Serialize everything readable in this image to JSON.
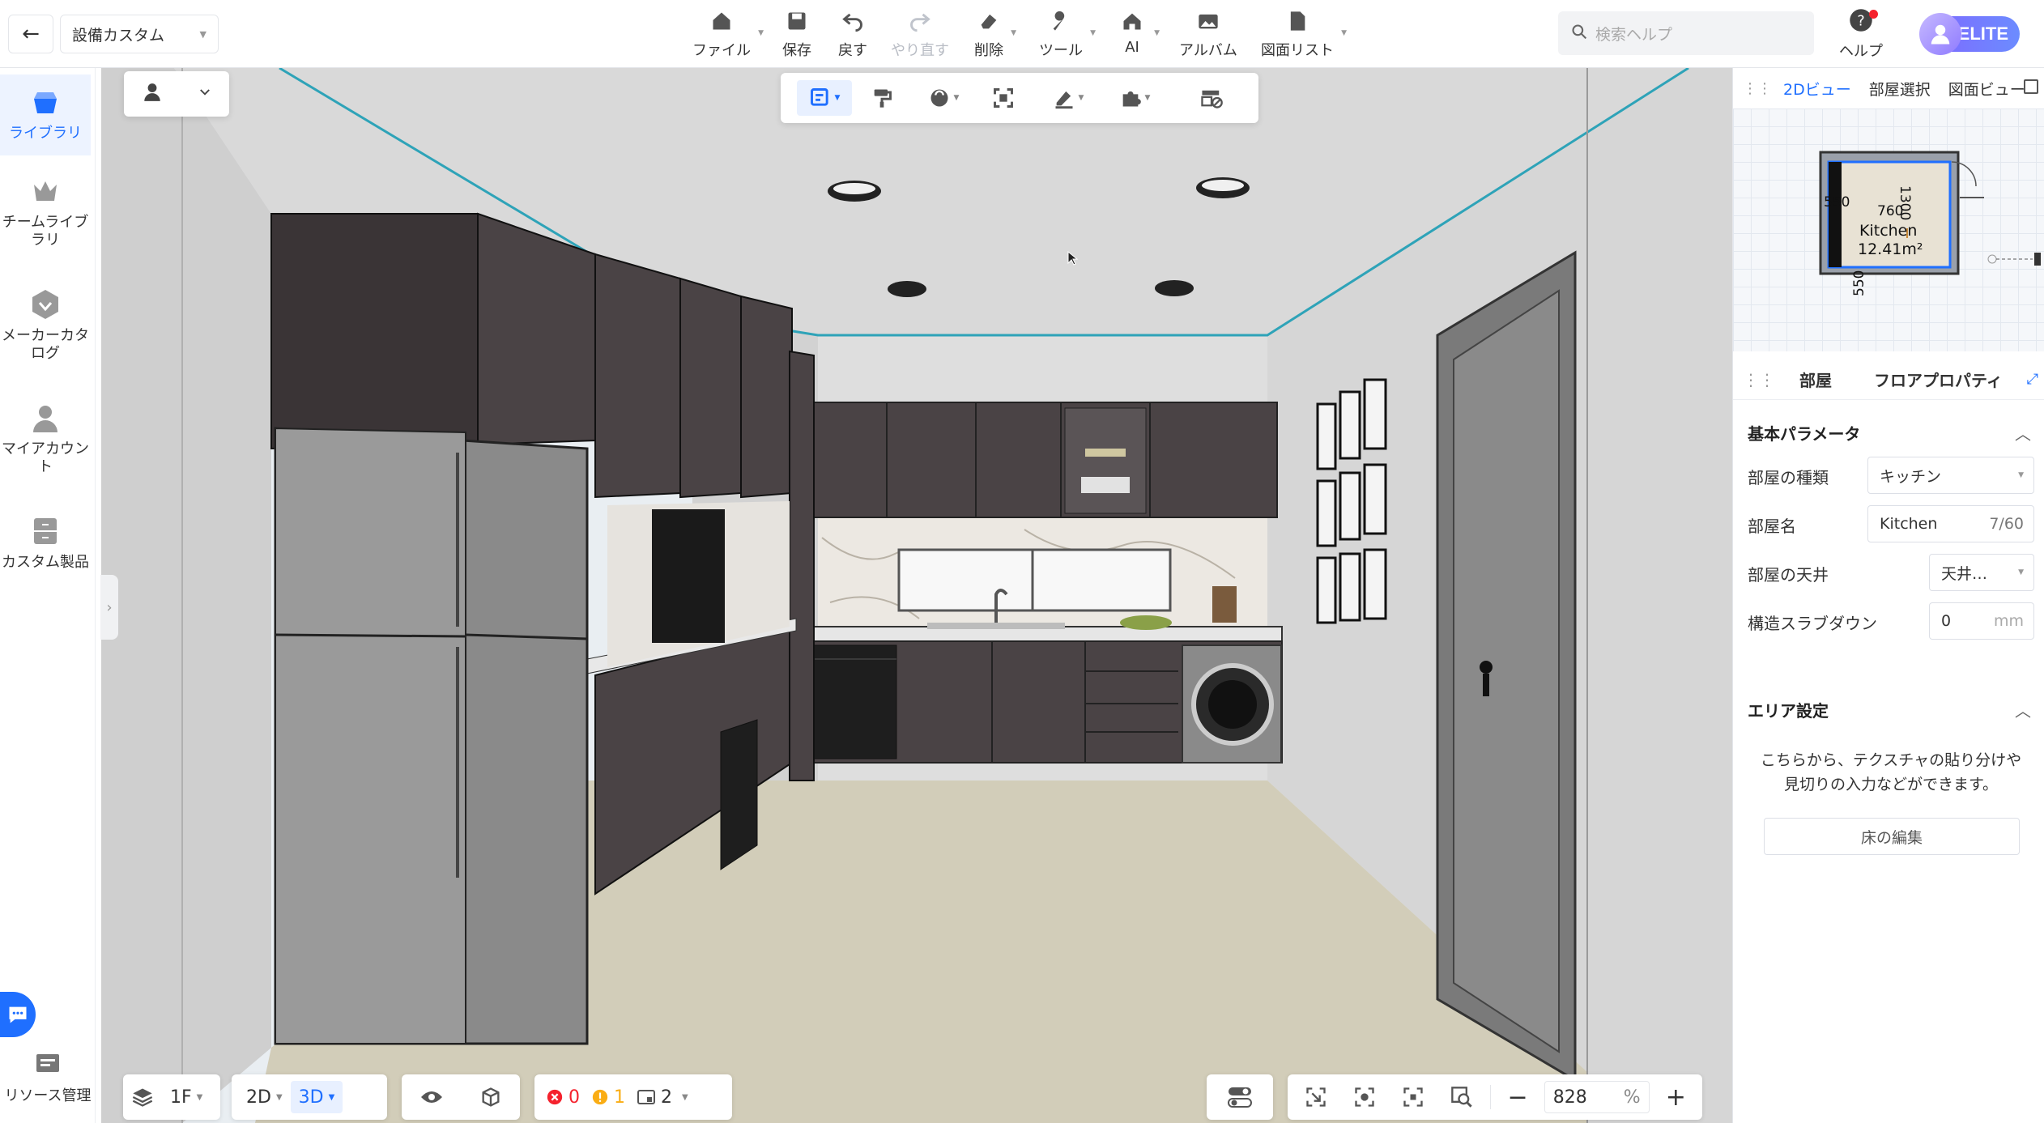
{
  "topbar": {
    "project_name": "設備カスタム",
    "file_label": "ファイル",
    "save_label": "保存",
    "undo_label": "戻す",
    "redo_label": "やり直す",
    "delete_label": "削除",
    "tools_label": "ツール",
    "ai_label": "AI",
    "album_label": "アルバム",
    "drawing_list_label": "図面リスト",
    "search_placeholder": "検索ヘルプ",
    "help_label": "ヘルプ",
    "plan_badge": "ELITE"
  },
  "sidebar": {
    "items": [
      {
        "label": "ライブラリ",
        "icon": "library-icon",
        "active": true
      },
      {
        "label": "チームライブラリ",
        "icon": "crown-icon",
        "active": false
      },
      {
        "label": "メーカーカタログ",
        "icon": "maker-badge-icon",
        "active": false
      },
      {
        "label": "マイアカウント",
        "icon": "person-icon",
        "active": false
      },
      {
        "label": "カスタム製品",
        "icon": "cabinet-icon",
        "active": false
      }
    ],
    "resource_label": "リソース管理"
  },
  "right_panel": {
    "view_tabs": [
      "2Dビュー",
      "部屋選択",
      "図面ビュー"
    ],
    "active_view_tab": "2Dビュー",
    "minimap": {
      "room_name": "Kitchen",
      "room_area": "12.41m²",
      "dim_width": "760",
      "dim_height": "1300",
      "dim_left_top": "550",
      "dim_left_bottom": "550"
    },
    "prop_tabs": [
      "部屋",
      "フロアプロパティ"
    ],
    "basic_section": "基本パラメータ",
    "room_type_label": "部屋の種類",
    "room_type_value": "キッチン",
    "room_name_label": "部屋名",
    "room_name_value": "Kitchen",
    "room_name_count": "7/60",
    "ceiling_label": "部屋の天井",
    "ceiling_value": "天井…",
    "slab_down_label": "構造スラブダウン",
    "slab_down_value": "0",
    "slab_down_unit": "mm",
    "area_section": "エリア設定",
    "area_description": "こちらから、テクスチャの貼り分けや 見切りの入力などができます。",
    "edit_floor_button": "床の編集"
  },
  "bottombar": {
    "floor": "1F",
    "view_2d": "2D",
    "view_3d": "3D",
    "error_count": "0",
    "warning_count": "1",
    "info_count": "2",
    "zoom_value": "828",
    "zoom_unit": "%"
  },
  "colors": {
    "accent": "#1f6fff",
    "cabinet": "#4a4345",
    "error": "#f5222d",
    "warning": "#faad14",
    "elite_gradient_start": "#7d6bff"
  }
}
